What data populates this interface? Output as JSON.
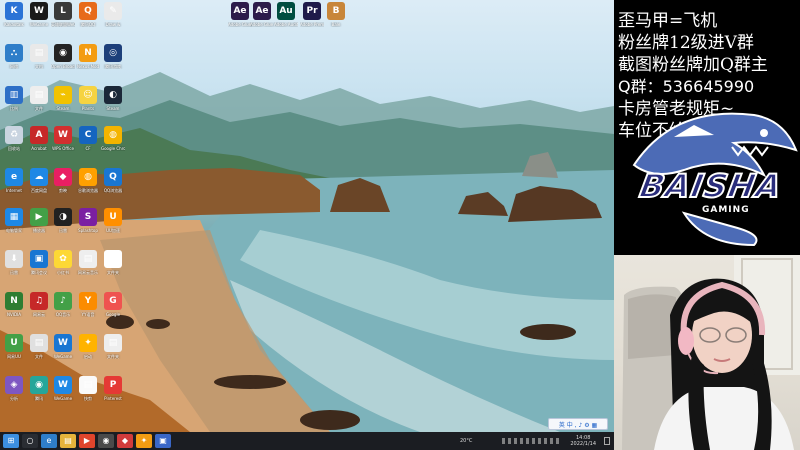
{
  "desktop": {
    "icons": [
      {
        "label": "Kakaotalk",
        "color": "#2b73d6",
        "glyph": "K"
      },
      {
        "label": "WeGame",
        "color": "#1a1a1a",
        "glyph": "W"
      },
      {
        "label": "英雄联盟WeGame版",
        "color": "#3a3a3a",
        "glyph": "L"
      },
      {
        "label": "腾讯QQ",
        "color": "#e76a1a",
        "glyph": "Q"
      },
      {
        "label": "Draw &",
        "color": "#eaeaea",
        "glyph": "✎"
      },
      {
        "label": "Adobe Glue 此电脑",
        "color": "#2c1b4a",
        "glyph": "Ae"
      },
      {
        "label": "Adobe Glue 此电脑",
        "color": "#2c1b4a",
        "glyph": "Ae"
      },
      {
        "label": "Adobe Audit",
        "color": "#004d40",
        "glyph": "Au"
      },
      {
        "label": "Adobe Premi",
        "color": "#1f1a4a",
        "glyph": "Pr"
      },
      {
        "label": "Bale",
        "color": "#c8863a",
        "glyph": "B"
      },
      {
        "label": "网络",
        "color": "#2f7ec9",
        "glyph": "⛬"
      },
      {
        "label": "文档",
        "color": "#e9e9e9",
        "glyph": "▤"
      },
      {
        "label": "Open Broadcast",
        "color": "#232323",
        "glyph": "◉"
      },
      {
        "label": "Nexus Mod",
        "color": "#f39c12",
        "glyph": "N"
      },
      {
        "label": "腾讯游戏",
        "color": "#1d3f7a",
        "glyph": "◎"
      },
      {
        "label": "比例",
        "color": "#2d6fc7",
        "glyph": "▥"
      },
      {
        "label": "文件",
        "color": "#eeeeee",
        "glyph": "▤"
      },
      {
        "label": "Steam",
        "color": "#f2c200",
        "glyph": "⌁"
      },
      {
        "label": "Plants",
        "color": "#f6d341",
        "glyph": "☺"
      },
      {
        "label": "Steam",
        "color": "#1b2838",
        "glyph": "◐"
      },
      {
        "label": "回收站",
        "color": "#c9d4e0",
        "glyph": "♻"
      },
      {
        "label": "Acrobat",
        "color": "#c62828",
        "glyph": "A"
      },
      {
        "label": "WPS Office",
        "color": "#d32f2f",
        "glyph": "W"
      },
      {
        "label": "CF",
        "color": "#1565c0",
        "glyph": "C"
      },
      {
        "label": "Google Chrome",
        "color": "#f4b400",
        "glyph": "◍"
      },
      {
        "label": "Internet",
        "color": "#1e88e5",
        "glyph": "e"
      },
      {
        "label": "百度网盘",
        "color": "#1e88e5",
        "glyph": "☁"
      },
      {
        "label": "剪映",
        "color": "#e91e63",
        "glyph": "◆"
      },
      {
        "label": "谷歌浏览器",
        "color": "#ffa000",
        "glyph": "◍"
      },
      {
        "label": "QQ浏览器",
        "color": "#1976d2",
        "glyph": "Q"
      },
      {
        "label": "电脑管家",
        "color": "#1e88e5",
        "glyph": "▦"
      },
      {
        "label": "播放器",
        "color": "#43a047",
        "glyph": "▶"
      },
      {
        "label": "迅雷",
        "color": "#212121",
        "glyph": "◑"
      },
      {
        "label": "Splashtop",
        "color": "#7b1fa2",
        "glyph": "S"
      },
      {
        "label": "UU加速",
        "color": "#ff8f00",
        "glyph": "U"
      },
      {
        "label": "迅雷",
        "color": "#e0e0e0",
        "glyph": "⬇"
      },
      {
        "label": "腾讯会议",
        "color": "#1976d2",
        "glyph": "▣"
      },
      {
        "label": "小红书",
        "color": "#fdd835",
        "glyph": "✿"
      },
      {
        "label": "网易云音乐",
        "color": "#eeeeee",
        "glyph": "▤"
      },
      {
        "label": "文件夹",
        "color": "#ffffff",
        "glyph": " "
      },
      {
        "label": "NVIDIA",
        "color": "#2e7d32",
        "glyph": "N"
      },
      {
        "label": "网易云",
        "color": "#c62828",
        "glyph": "♫"
      },
      {
        "label": "QQ音乐",
        "color": "#43a047",
        "glyph": "♪"
      },
      {
        "label": "YY语音",
        "color": "#fb8c00",
        "glyph": "Y"
      },
      {
        "label": "Google",
        "color": "#ef5350",
        "glyph": "G"
      },
      {
        "label": "网易UU",
        "color": "#43a047",
        "glyph": "U"
      },
      {
        "label": "文件",
        "color": "#e0e0e0",
        "glyph": "▤"
      },
      {
        "label": "WeGame",
        "color": "#1976d2",
        "glyph": "W"
      },
      {
        "label": "启动",
        "color": "#ffb300",
        "glyph": "✦"
      },
      {
        "label": "文件夹",
        "color": "#eeeeee",
        "glyph": "▤"
      },
      {
        "label": "分析",
        "color": "#7e57c2",
        "glyph": "◈"
      },
      {
        "label": "腾讯",
        "color": "#26a69a",
        "glyph": "◉"
      },
      {
        "label": "WeGame",
        "color": "#1e88e5",
        "glyph": "W"
      },
      {
        "label": "快剪",
        "color": "#fafafa",
        "glyph": "▤"
      },
      {
        "label": "Pinterest",
        "color": "#e53935",
        "glyph": "P"
      }
    ],
    "ime_bar": {
      "text": "英 中 , ♪ ⚙ ▦"
    }
  },
  "taskbar": {
    "apps": [
      {
        "name": "start",
        "color": "#3c8fe0",
        "glyph": "⊞"
      },
      {
        "name": "search",
        "color": "#2a2d33",
        "glyph": "○"
      },
      {
        "name": "edge",
        "color": "#2f7ec9",
        "glyph": "e"
      },
      {
        "name": "folder",
        "color": "#e6b33b",
        "glyph": "▤"
      },
      {
        "name": "media",
        "color": "#e0452c",
        "glyph": "▶"
      },
      {
        "name": "obs",
        "color": "#4a4a4a",
        "glyph": "◉"
      },
      {
        "name": "game",
        "color": "#d13b3b",
        "glyph": "◆"
      },
      {
        "name": "tool",
        "color": "#f39c12",
        "glyph": "✦"
      },
      {
        "name": "app",
        "color": "#3a67c7",
        "glyph": "▣"
      }
    ],
    "temperature": "20°C",
    "time": "14:08",
    "date": "2022/1/14"
  },
  "stream": {
    "lines": [
      "歪马甲=飞机",
      "粉丝牌12级进V群",
      "截图粉丝牌加Q群主",
      "Q群：536645990",
      "卡房管老规矩~",
      "车位不给嫖哼"
    ],
    "logo_brand": "BAISHA",
    "logo_sub": "GAMING",
    "colors": {
      "logo_blue": "#2a2d7c",
      "shark": "#4c6bb6",
      "text": "#ffffff"
    }
  }
}
